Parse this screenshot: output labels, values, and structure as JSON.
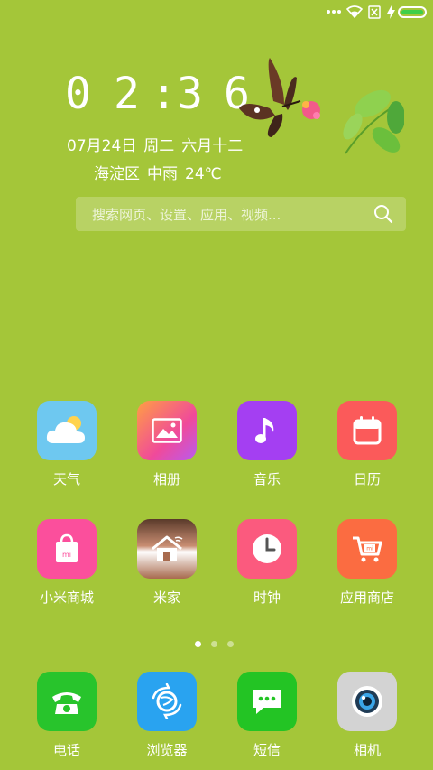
{
  "clock": {
    "h1": "0",
    "h2": "2",
    "colon": ":",
    "m1": "3",
    "m2": "6"
  },
  "date": {
    "day": "07月24日",
    "weekday": "周二",
    "lunar": "六月十二"
  },
  "weather": {
    "district": "海淀区",
    "condition": "中雨",
    "temp": "24℃"
  },
  "search": {
    "placeholder": "搜索网页、设置、应用、视频..."
  },
  "apps_row1": [
    {
      "label": "天气"
    },
    {
      "label": "相册"
    },
    {
      "label": "音乐"
    },
    {
      "label": "日历"
    }
  ],
  "apps_row2": [
    {
      "label": "小米商城"
    },
    {
      "label": "米家"
    },
    {
      "label": "时钟"
    },
    {
      "label": "应用商店"
    }
  ],
  "dock": [
    {
      "label": "电话"
    },
    {
      "label": "浏览器"
    },
    {
      "label": "短信"
    },
    {
      "label": "相机"
    }
  ],
  "colors": {
    "background": "#a4c639",
    "battery": "#3ecf4a",
    "weather_icon": "#6ec8f0",
    "gallery_icon": "#f66ea0",
    "music_icon": "#a43ff2",
    "calendar_icon": "#fb5a5a",
    "mall_icon": "#fb4f9c",
    "mijia_icon": "#a86b4e",
    "clock_icon": "#fb5a7e",
    "appstore_icon": "#fb6c41",
    "phone_icon": "#28c42c",
    "browser_icon": "#29a3f0",
    "sms_icon": "#23c424",
    "camera_icon": "#d3d3d3"
  },
  "pager": {
    "pages": 3,
    "current": 1
  }
}
